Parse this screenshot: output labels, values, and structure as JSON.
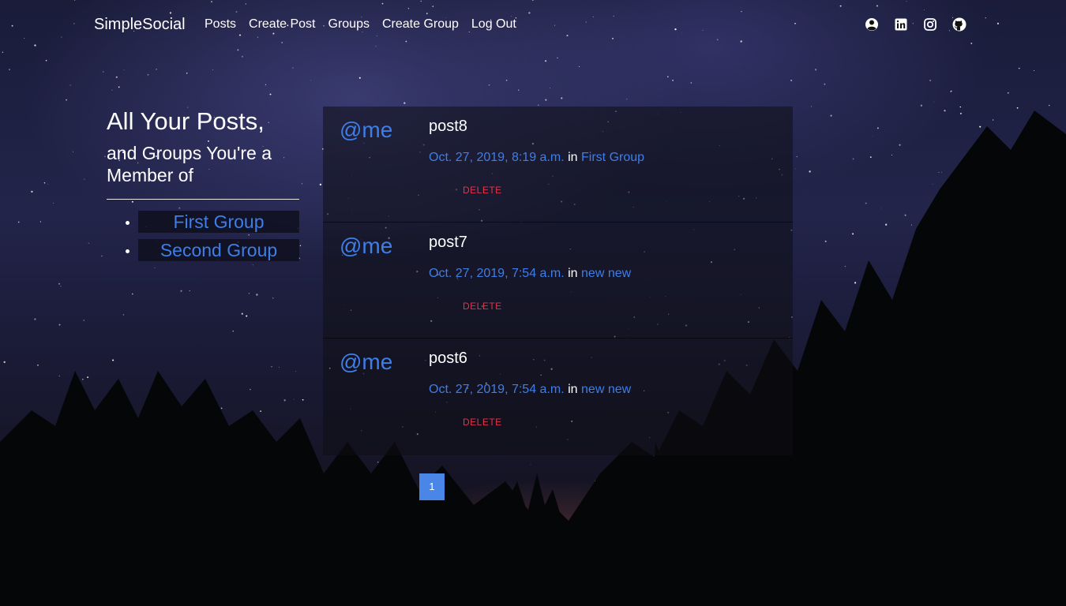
{
  "nav": {
    "brand": "SimpleSocial",
    "links": [
      "Posts",
      "Create Post",
      "Groups",
      "Create Group",
      "Log Out"
    ],
    "social_icons": [
      "user-circle-icon",
      "linkedin-icon",
      "instagram-icon",
      "github-icon"
    ]
  },
  "sidebar": {
    "title": "All Your Posts,",
    "subtitle": "and Groups You're a Member of",
    "groups": [
      "First Group",
      "Second Group"
    ]
  },
  "posts": [
    {
      "author": "@me",
      "title": "post8",
      "date": "Oct. 27, 2019, 8:19 a.m.",
      "in_label": "in",
      "group": "First Group",
      "delete_label": "DELETE"
    },
    {
      "author": "@me",
      "title": "post7",
      "date": "Oct. 27, 2019, 7:54 a.m.",
      "in_label": "in",
      "group": "new new",
      "delete_label": "DELETE"
    },
    {
      "author": "@me",
      "title": "post6",
      "date": "Oct. 27, 2019, 7:54 a.m.",
      "in_label": "in",
      "group": "new new",
      "delete_label": "DELETE"
    }
  ],
  "pagination": {
    "current_page": "1"
  },
  "colors": {
    "link": "#3d7ee8",
    "delete": "#e0344a",
    "page_active": "#4a86e8"
  }
}
